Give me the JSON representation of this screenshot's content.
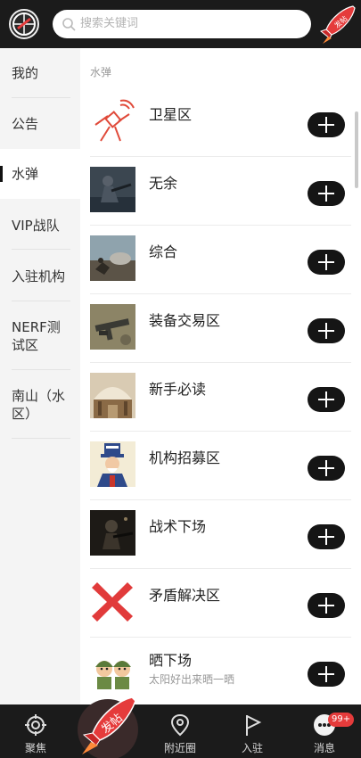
{
  "header": {
    "search_placeholder": "搜索关键词",
    "post_badge": "发帖"
  },
  "sidebar": {
    "items": [
      {
        "label": "我的"
      },
      {
        "label": "公告"
      },
      {
        "label": "水弹",
        "active": true
      },
      {
        "label": "VIP战队"
      },
      {
        "label": "入驻机构"
      },
      {
        "label": "NERF测试区"
      },
      {
        "label": "南山（水区）"
      }
    ]
  },
  "main": {
    "section_title": "水弹",
    "forums": [
      {
        "name": "卫星区",
        "icon": "satellite-icon"
      },
      {
        "name": "无余",
        "icon": "soldier-photo"
      },
      {
        "name": "综合",
        "icon": "battlefield-photo"
      },
      {
        "name": "装备交易区",
        "icon": "gun-photo"
      },
      {
        "name": "新手必读",
        "icon": "library-photo"
      },
      {
        "name": "机构招募区",
        "icon": "uncle-sam-photo"
      },
      {
        "name": "战术下场",
        "icon": "tactical-photo"
      },
      {
        "name": "矛盾解决区",
        "icon": "red-x-icon"
      },
      {
        "name": "晒下场",
        "sub": "太阳好出来晒一晒",
        "icon": "cartoon-soldiers"
      }
    ]
  },
  "bottom_nav": {
    "tabs": [
      {
        "label": "聚焦",
        "icon": "focus-icon"
      },
      {
        "label": "发帖",
        "icon": "rocket-icon"
      },
      {
        "label": "附近圈",
        "icon": "location-icon"
      },
      {
        "label": "入驻",
        "icon": "flag-icon"
      },
      {
        "label": "消息",
        "icon": "message-icon"
      }
    ],
    "message_badge": "99+"
  },
  "colors": {
    "bar_bg": "#1b1b1b",
    "accent": "#e53b3b",
    "sidebar_bg": "#f4f4f4"
  }
}
